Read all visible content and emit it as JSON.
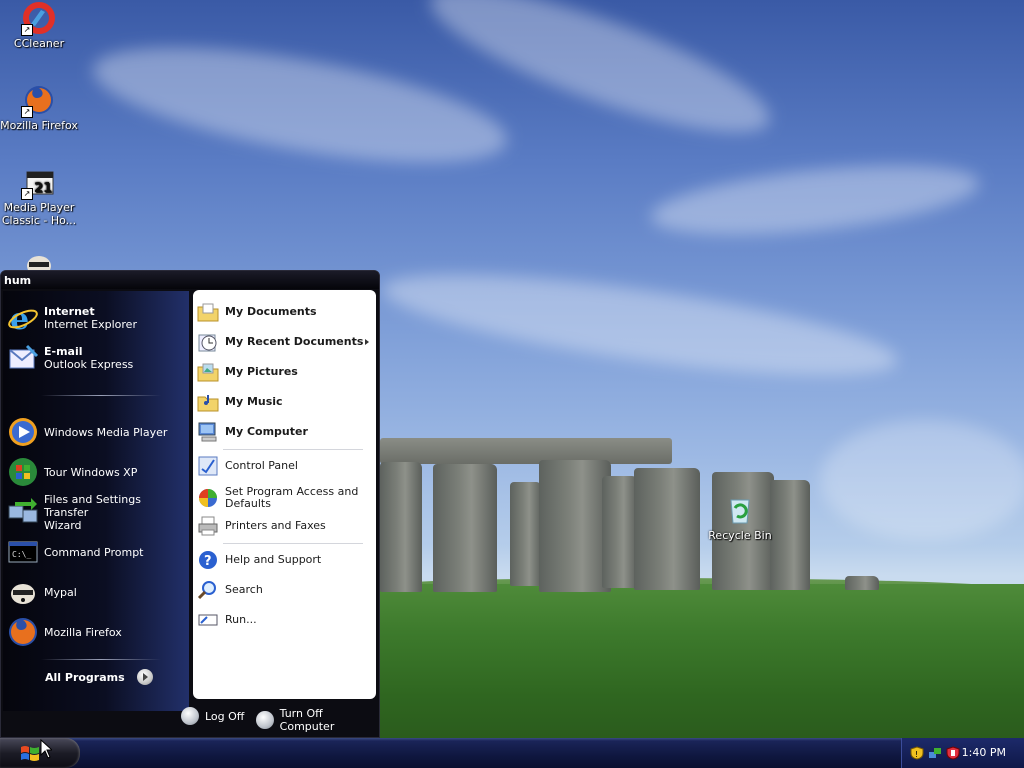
{
  "desktop": {
    "icons": [
      {
        "label": "CCleaner",
        "icon": "ccleaner-icon"
      },
      {
        "label": "Mozilla Firefox",
        "icon": "firefox-icon"
      },
      {
        "label": "Media Player Classic - Ho...",
        "label_line1": "Media Player",
        "label_line2": "Classic - Ho...",
        "icon": "media-player-classic-icon"
      },
      {
        "label": "",
        "icon": "mypal-icon"
      },
      {
        "label": "Recycle Bin",
        "icon": "recycle-bin-icon"
      }
    ]
  },
  "start_menu": {
    "username": "hum",
    "pinned": [
      {
        "title": "Internet",
        "subtitle": "Internet Explorer",
        "icon": "internet-explorer-icon"
      },
      {
        "title": "E-mail",
        "subtitle": "Outlook Express",
        "icon": "outlook-express-icon"
      }
    ],
    "recent": [
      {
        "label": "Windows Media Player",
        "icon": "windows-media-player-icon"
      },
      {
        "label": "Tour Windows XP",
        "icon": "tour-windows-xp-icon"
      },
      {
        "label": "Files and Settings Transfer Wizard",
        "line1": "Files and Settings Transfer",
        "line2": "Wizard",
        "icon": "transfer-wizard-icon"
      },
      {
        "label": "Command Prompt",
        "icon": "command-prompt-icon"
      },
      {
        "label": "Mypal",
        "icon": "mypal-icon"
      },
      {
        "label": "Mozilla Firefox",
        "icon": "firefox-icon"
      }
    ],
    "all_programs": "All Programs",
    "places": [
      {
        "label": "My Documents",
        "icon": "my-documents-icon"
      },
      {
        "label": "My Recent Documents",
        "icon": "recent-documents-icon",
        "submenu": true
      },
      {
        "label": "My Pictures",
        "icon": "my-pictures-icon"
      },
      {
        "label": "My Music",
        "icon": "my-music-icon"
      },
      {
        "label": "My Computer",
        "icon": "my-computer-icon"
      }
    ],
    "system": [
      {
        "label": "Control Panel",
        "icon": "control-panel-icon"
      },
      {
        "label": "Set Program Access and Defaults",
        "line1": "Set Program Access and",
        "line2": "Defaults",
        "icon": "program-access-icon"
      },
      {
        "label": "Printers and Faxes",
        "icon": "printer-icon"
      }
    ],
    "help": [
      {
        "label": "Help and Support",
        "icon": "help-icon"
      },
      {
        "label": "Search",
        "icon": "search-icon"
      },
      {
        "label": "Run...",
        "icon": "run-icon"
      }
    ],
    "log_off": "Log Off",
    "turn_off": "Turn Off Computer"
  },
  "taskbar": {
    "clock": "1:40 PM",
    "tray_icons": [
      "security-shield-icon",
      "network-icon",
      "antivirus-shield-icon"
    ]
  },
  "colors": {
    "start_menu_bg": "#0c0c12",
    "taskbar_bg": "#0f173f",
    "right_pane_bg": "#ffffff"
  }
}
